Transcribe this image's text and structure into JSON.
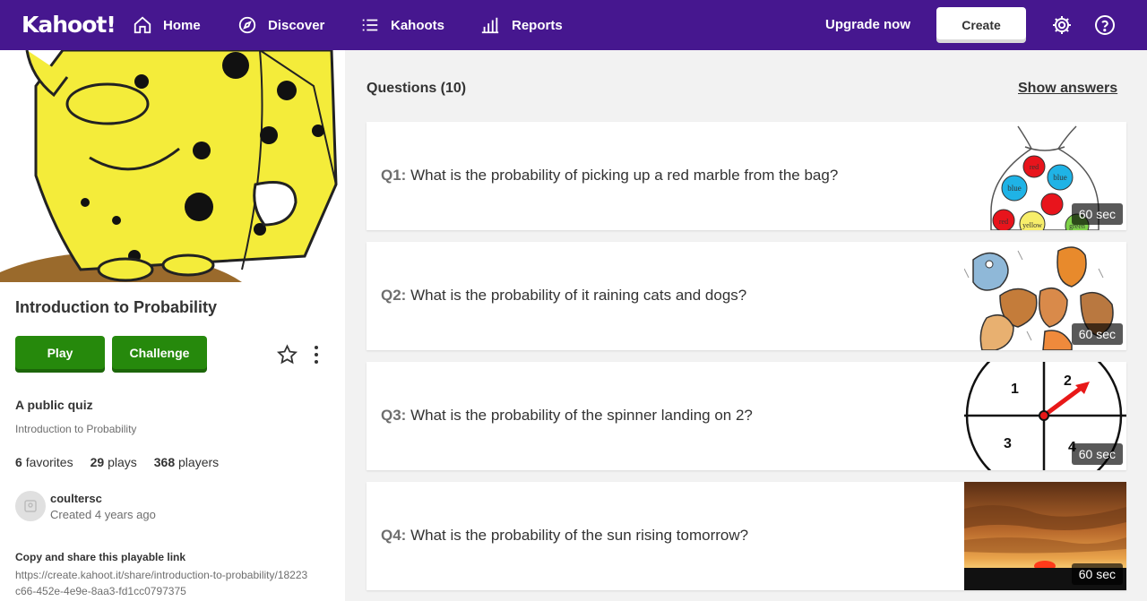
{
  "nav": {
    "logo": "Kahoot!",
    "items": [
      {
        "label": "Home",
        "icon": "home-icon"
      },
      {
        "label": "Discover",
        "icon": "compass-icon"
      },
      {
        "label": "Kahoots",
        "icon": "list-icon"
      },
      {
        "label": "Reports",
        "icon": "bar-chart-icon"
      }
    ],
    "upgrade": "Upgrade now",
    "create": "Create",
    "settings_icon": "gear-icon",
    "help_icon": "help-icon"
  },
  "quiz": {
    "title": "Introduction to Probability",
    "play": "Play",
    "challenge": "Challenge",
    "visibility": "A public quiz",
    "description": "Introduction to Probability",
    "favorites_count": "6",
    "favorites_label": "favorites",
    "plays_count": "29",
    "plays_label": "plays",
    "players_count": "368",
    "players_label": "players",
    "author": "coultersc",
    "created": "Created 4 years ago",
    "share_label": "Copy and share this playable link",
    "share_link": "https://create.kahoot.it/share/introduction-to-probability/18223c66-452e-4e9e-8aa3-fd1cc0797375"
  },
  "questions_header": "Questions (10)",
  "show_answers": "Show answers",
  "questions": [
    {
      "num": "Q1:",
      "text": "What is the probability of picking up a red marble from the bag?",
      "time": "60 sec"
    },
    {
      "num": "Q2:",
      "text": "What is the probability of it raining cats and dogs?",
      "time": "60 sec"
    },
    {
      "num": "Q3:",
      "text": "What is the probability of the spinner landing on 2?",
      "time": "60 sec"
    },
    {
      "num": "Q4:",
      "text": "What is the probability of the sun rising tomorrow?",
      "time": "60 sec"
    }
  ],
  "marble_labels": {
    "red": "red",
    "blue": "blue",
    "yellow": "yellow",
    "green": "green"
  },
  "spinner_labels": [
    "1",
    "2",
    "3",
    "4"
  ],
  "colors": {
    "nav": "#46178f",
    "play": "#26890c"
  }
}
